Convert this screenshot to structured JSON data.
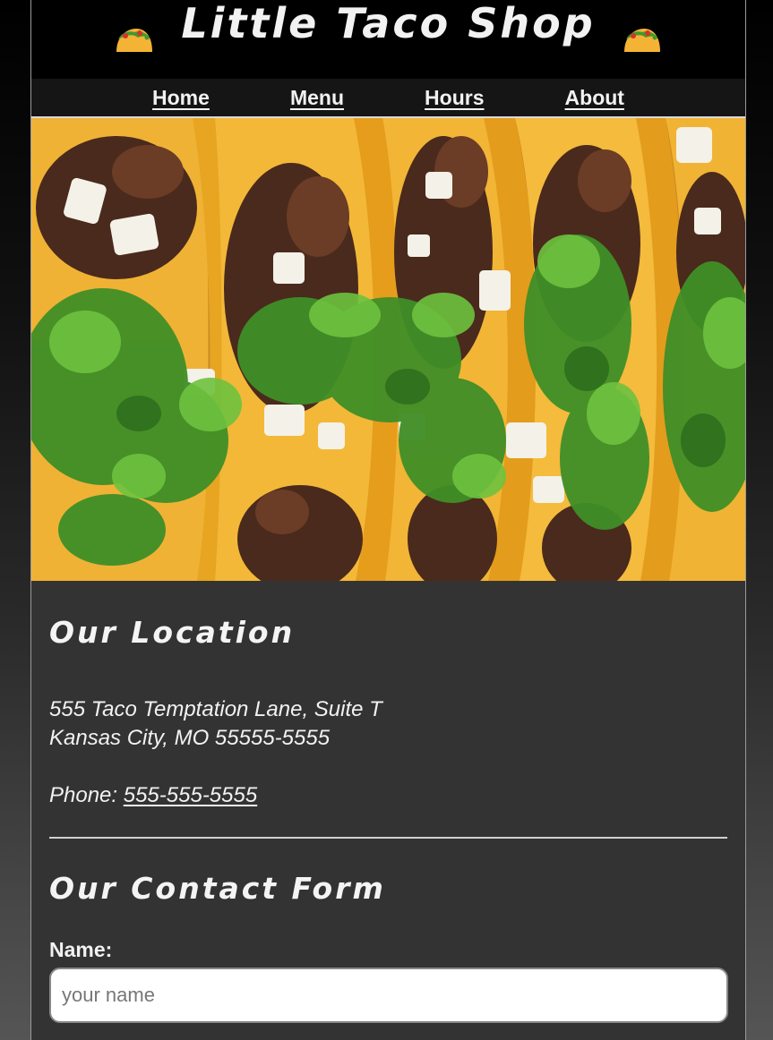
{
  "header": {
    "title": "Little Taco Shop",
    "left_icon": "taco-icon",
    "right_icon": "taco-icon"
  },
  "nav": {
    "items": [
      {
        "label": "Home"
      },
      {
        "label": "Menu"
      },
      {
        "label": "Hours"
      },
      {
        "label": "About"
      }
    ]
  },
  "hero": {
    "image": "tacos-photo"
  },
  "location": {
    "title": "Our Location",
    "address_line1": "555 Taco Temptation Lane, Suite T",
    "address_line2": "Kansas City, MO 55555-5555",
    "phone_label": "Phone: ",
    "phone_number": "555-555-5555"
  },
  "contact": {
    "title": "Our Contact Form",
    "name_label": "Name:",
    "name_placeholder": "your name",
    "name_value": ""
  },
  "colors": {
    "page_bg": "#333333",
    "header_bg": "#000000",
    "nav_bg": "#151515",
    "text": "#f2f2f2",
    "taco_shell": "#f5b335",
    "lettuce": "#3f9a2f"
  }
}
